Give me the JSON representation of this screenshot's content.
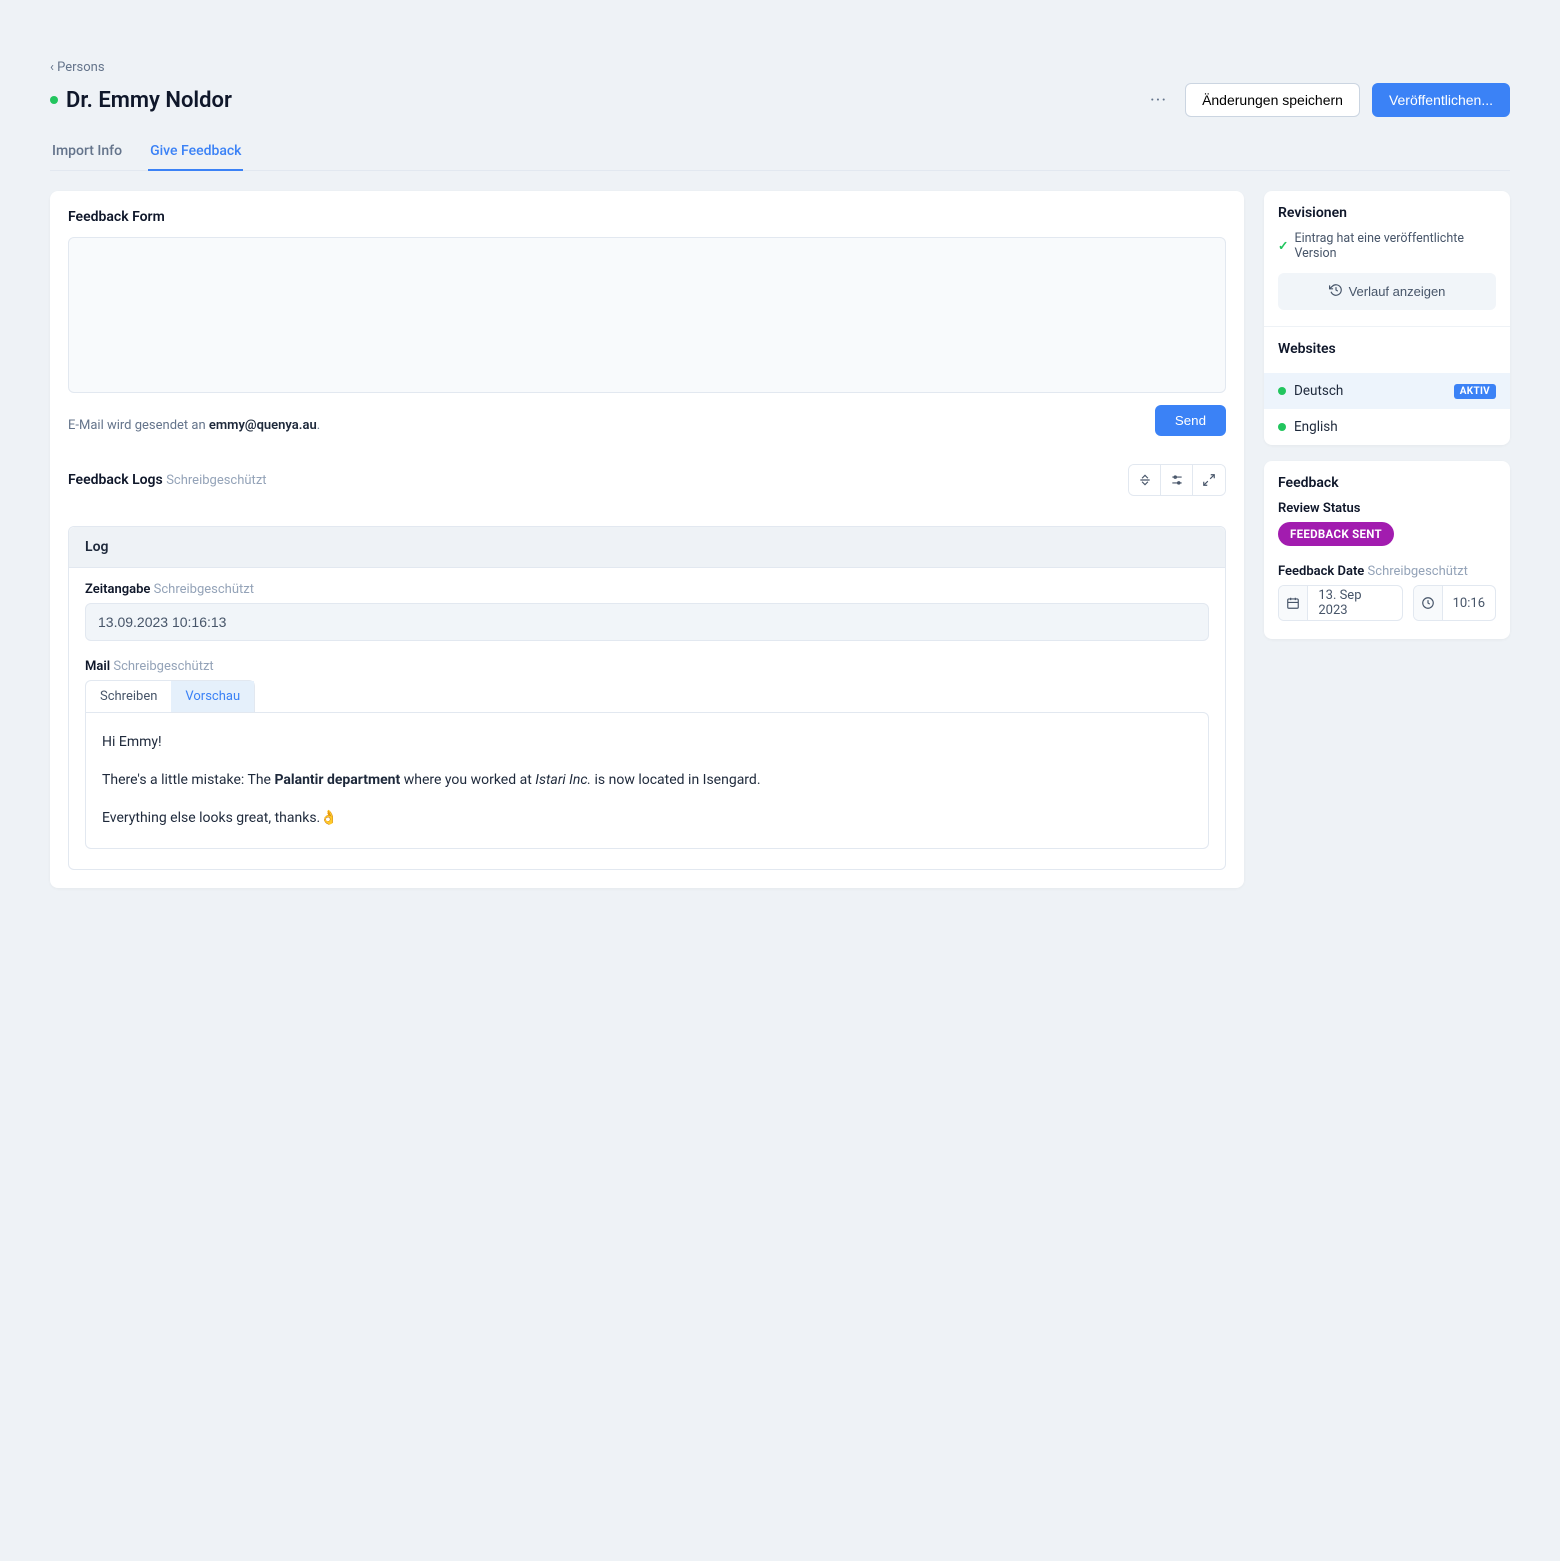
{
  "breadcrumb": "Persons",
  "title": "Dr. Emmy Noldor",
  "header_actions": {
    "more": "···",
    "save": "Änderungen speichern",
    "publish": "Veröffentlichen..."
  },
  "tabs": [
    {
      "label": "Import Info",
      "active": false
    },
    {
      "label": "Give Feedback",
      "active": true
    }
  ],
  "feedback_form": {
    "title": "Feedback Form",
    "value": "",
    "hint_prefix": "E-Mail wird gesendet an ",
    "hint_email": "emmy@quenya.au",
    "hint_suffix": ".",
    "send": "Send"
  },
  "feedback_logs": {
    "title": "Feedback Logs",
    "readonly": "Schreibgeschützt"
  },
  "log": {
    "header": "Log",
    "timestamp_label": "Zeitangabe",
    "timestamp_readonly": "Schreibgeschützt",
    "timestamp_value": "13.09.2023 10:16:13",
    "mail_label": "Mail",
    "mail_readonly": "Schreibgeschützt",
    "mail_tabs": {
      "write": "Schreiben",
      "preview": "Vorschau"
    },
    "mail_body": {
      "p1": "Hi Emmy!",
      "p2_a": "There's a little mistake: The ",
      "p2_b": "Palantir department",
      "p2_c": " where you worked at ",
      "p2_d": "Istari Inc.",
      "p2_e": " is now located in Isengard.",
      "p3": "Everything else looks great, thanks.👌"
    }
  },
  "sidebar": {
    "revisions": {
      "title": "Revisionen",
      "published_msg": "Eintrag hat eine veröffentlichte Version",
      "history_btn": "Verlauf anzeigen"
    },
    "websites": {
      "title": "Websites",
      "items": [
        {
          "label": "Deutsch",
          "badge": "AKTIV",
          "active": true
        },
        {
          "label": "English",
          "badge": "",
          "active": false
        }
      ]
    },
    "feedback": {
      "title": "Feedback",
      "review_status_label": "Review Status",
      "review_status_value": "FEEDBACK SENT",
      "feedback_date_label": "Feedback Date",
      "feedback_date_readonly": "Schreibgeschützt",
      "date": "13. Sep 2023",
      "time": "10:16"
    }
  }
}
